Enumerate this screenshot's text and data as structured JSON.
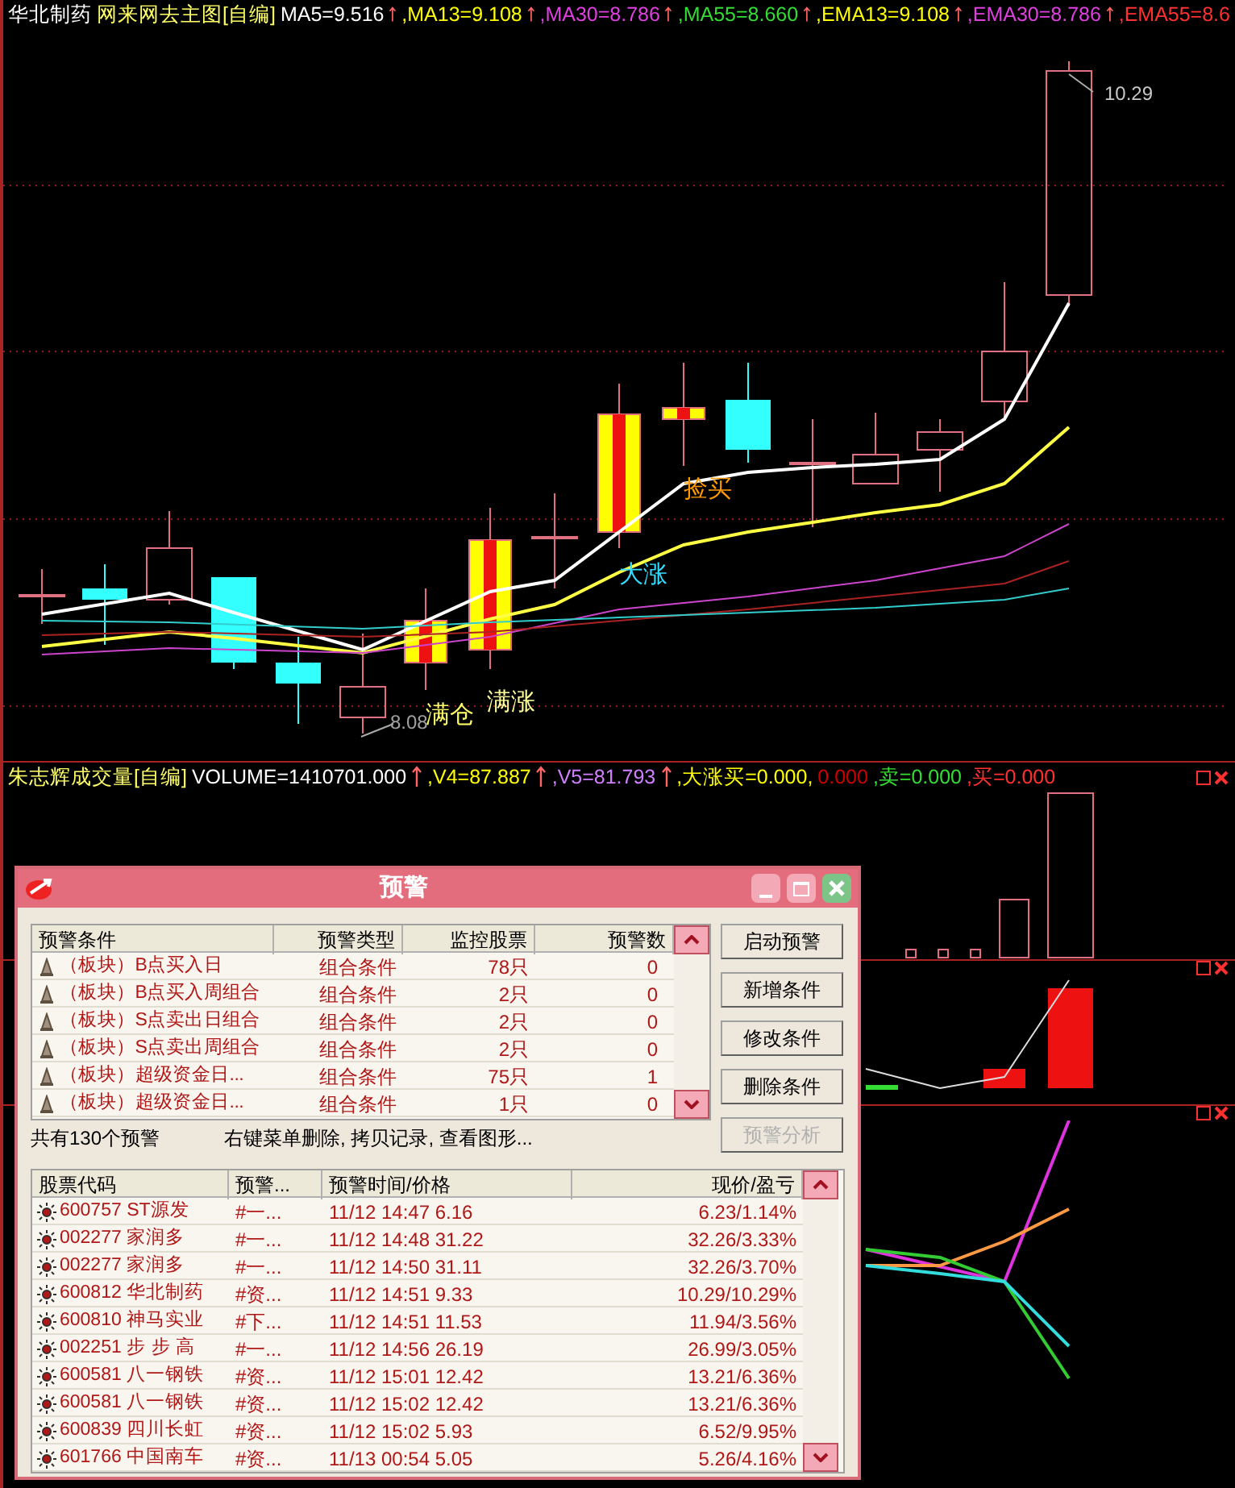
{
  "main_chart": {
    "legend": [
      {
        "text": "华北制药",
        "color": "#ffffff",
        "arrow": false
      },
      {
        "text": "网来网去主图[自编]",
        "color": "#ffff66",
        "arrow": false
      },
      {
        "text": "MA5=9.516",
        "color": "#ffffff",
        "arrow": true
      },
      {
        "text": ",MA13=9.108",
        "color": "#ffff00",
        "arrow": true
      },
      {
        "text": ",MA30=8.786",
        "color": "#e040e0",
        "arrow": true
      },
      {
        "text": ",MA55=8.660",
        "color": "#33dd33",
        "arrow": true
      },
      {
        "text": ",EMA13=9.108",
        "color": "#ffff00",
        "arrow": true
      },
      {
        "text": ",EMA30=8.786",
        "color": "#e040e0",
        "arrow": true
      },
      {
        "text": ",EMA55=8.6",
        "color": "#ff3030",
        "arrow": false
      }
    ],
    "annotations": [
      {
        "text": "10.29",
        "color": "#c8c8c8"
      },
      {
        "text": "8.08",
        "color": "#a0a0a0"
      },
      {
        "text": "满仓",
        "color": "#ffff66"
      },
      {
        "text": "满涨",
        "color": "#ffff99"
      },
      {
        "text": "大涨",
        "color": "#33ddff"
      },
      {
        "text": "捡买",
        "color": "#ff9900"
      }
    ]
  },
  "volume_chart": {
    "legend": [
      {
        "text": "朱志辉成交量[自编]",
        "color": "#ffff66",
        "arrow": false
      },
      {
        "text": "VOLUME=1410701.000",
        "color": "#ffffff",
        "arrow": true
      },
      {
        "text": ",V4=87.887",
        "color": "#ffff00",
        "arrow": true
      },
      {
        "text": ",V5=81.793",
        "color": "#d080ff",
        "arrow": true
      },
      {
        "text": ",大涨买=0.000,",
        "color": "#ffff00",
        "arrow": false
      },
      {
        "text": "0.000",
        "color": "#cc0000",
        "arrow": false
      },
      {
        "text": ",卖=0.000",
        "color": "#33dd33",
        "arrow": false
      },
      {
        "text": ",买=0.000",
        "color": "#ff3030",
        "arrow": false
      }
    ]
  },
  "dialog": {
    "title": "预警",
    "conditions": {
      "columns": [
        "预警条件",
        "预警类型",
        "监控股票",
        "预警数"
      ],
      "rows": [
        {
          "name": "（板块）B点买入日",
          "type": "组合条件",
          "stocks": "78只",
          "count": "0"
        },
        {
          "name": "（板块）B点买入周组合",
          "type": "组合条件",
          "stocks": "2只",
          "count": "0"
        },
        {
          "name": "（板块）S点卖出日组合",
          "type": "组合条件",
          "stocks": "2只",
          "count": "0"
        },
        {
          "name": "（板块）S点卖出周组合",
          "type": "组合条件",
          "stocks": "2只",
          "count": "0"
        },
        {
          "name": "（板块）超级资金日...",
          "type": "组合条件",
          "stocks": "75只",
          "count": "1"
        },
        {
          "name": "（板块）超级资金日...",
          "type": "组合条件",
          "stocks": "1只",
          "count": "0"
        }
      ]
    },
    "buttons": [
      {
        "label": "启动预警",
        "disabled": false
      },
      {
        "label": "新增条件",
        "disabled": false
      },
      {
        "label": "修改条件",
        "disabled": false
      },
      {
        "label": "删除条件",
        "disabled": false
      },
      {
        "label": "预警分析",
        "disabled": true
      }
    ],
    "status": "共有130个预警",
    "hint": "右键菜单删除, 拷贝记录, 查看图形...",
    "alerts": {
      "columns": [
        "股票代码",
        "预警...",
        "预警时间/价格",
        "现价/盈亏"
      ],
      "rows": [
        {
          "stock": "600757 ST源发",
          "condition": "#一...",
          "time_price": "11/12 14:47 6.16",
          "result": "6.23/1.14%"
        },
        {
          "stock": "002277 家润多",
          "condition": "#一...",
          "time_price": "11/12 14:48 31.22",
          "result": "32.26/3.33%"
        },
        {
          "stock": "002277 家润多",
          "condition": "#一...",
          "time_price": "11/12 14:50 31.11",
          "result": "32.26/3.70%"
        },
        {
          "stock": "600812 华北制药",
          "condition": "#资...",
          "time_price": "11/12 14:51 9.33",
          "result": "10.29/10.29%"
        },
        {
          "stock": "600810 神马实业",
          "condition": "#下...",
          "time_price": "11/12 14:51 11.53",
          "result": "11.94/3.56%"
        },
        {
          "stock": "002251 步 步 高",
          "condition": "#一...",
          "time_price": "11/12 14:56 26.19",
          "result": "26.99/3.05%"
        },
        {
          "stock": "600581 八一钢铁",
          "condition": "#资...",
          "time_price": "11/12 15:01 12.42",
          "result": "13.21/6.36%"
        },
        {
          "stock": "600581 八一钢铁",
          "condition": "#资...",
          "time_price": "11/12 15:02 12.42",
          "result": "13.21/6.36%"
        },
        {
          "stock": "600839 四川长虹",
          "condition": "#资...",
          "time_price": "11/12 15:02 5.93",
          "result": "6.52/9.95%"
        },
        {
          "stock": "601766 中国南车",
          "condition": "#资...",
          "time_price": "11/13 00:54 5.05",
          "result": "5.26/4.16%"
        }
      ]
    }
  }
}
